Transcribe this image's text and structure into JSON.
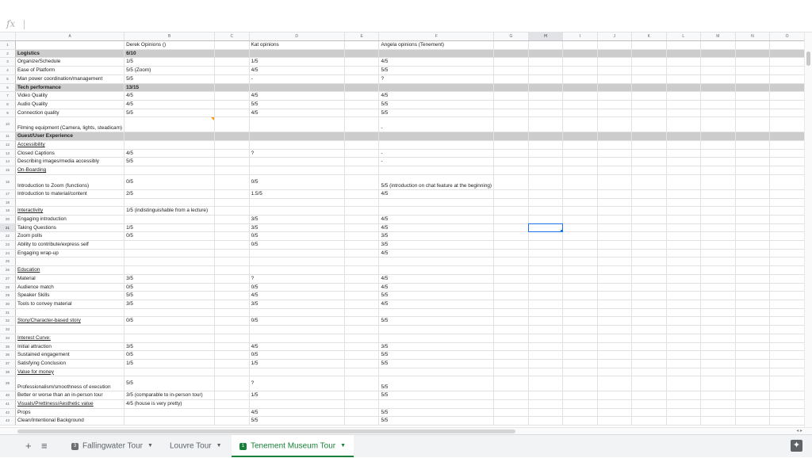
{
  "formula_bar": {
    "fx_label": "fx"
  },
  "columns": [
    "A",
    "B",
    "C",
    "D",
    "E",
    "F",
    "G",
    "H",
    "I",
    "J",
    "K",
    "L",
    "M",
    "N",
    "O"
  ],
  "selected_column": "H",
  "selected_row": "21",
  "rows": [
    {
      "n": "1",
      "a": "",
      "b": "Derek Opinions ()",
      "d": "Kat opinions",
      "f": "Angela opinions (Tenement)"
    },
    {
      "n": "2",
      "a": "Logistics",
      "b": "6/10",
      "d": "",
      "f": ""
    },
    {
      "n": "3",
      "a": "Organize/Schedule",
      "b": "1/5",
      "d": "1/5",
      "f": "4/5"
    },
    {
      "n": "4",
      "a": "Ease of Platform",
      "b": "5/5 (Zoom)",
      "d": "4/5",
      "f": "5/5"
    },
    {
      "n": "5",
      "a": "Man power coordination/management",
      "b": "5/5",
      "d": "-",
      "f": "?"
    },
    {
      "n": "6",
      "a": "Tech performance",
      "b": "13/15",
      "d": "",
      "f": ""
    },
    {
      "n": "7",
      "a": "Video Quality",
      "b": "4/5",
      "d": "4/5",
      "f": "4/5"
    },
    {
      "n": "8",
      "a": "Audio Quality",
      "b": "4/5",
      "d": "5/5",
      "f": "5/5"
    },
    {
      "n": "9",
      "a": "Connection quality",
      "b": "5/5",
      "d": "4/5",
      "f": "5/5"
    },
    {
      "n": "10",
      "a": "Filming equipment (Camera, lights, steadicam)",
      "b": "",
      "d": "",
      "f": "-"
    },
    {
      "n": "11",
      "a": "Guest/User Experience",
      "b": "",
      "d": "",
      "f": ""
    },
    {
      "n": "12",
      "a": "Accessibility",
      "b": "",
      "d": "",
      "f": ""
    },
    {
      "n": "13",
      "a": "Closed Captions",
      "b": "4/5",
      "d": "?",
      "f": "-"
    },
    {
      "n": "14",
      "a": "Describing images/media accessibly",
      "b": "5/5",
      "d": "",
      "f": "-"
    },
    {
      "n": "15",
      "a": "On-Boarding",
      "b": "",
      "d": "",
      "f": ""
    },
    {
      "n": "16",
      "a": "Introduction to Zoom (functions)",
      "b": "0/5",
      "d": "0/5",
      "f": "5/5 (introduction on chat feature at the beginning)"
    },
    {
      "n": "17",
      "a": "Introduction to material/content",
      "b": "2/5",
      "d": "1.5/5",
      "f": "4/5"
    },
    {
      "n": "18",
      "a": "",
      "b": "",
      "d": "",
      "f": ""
    },
    {
      "n": "19",
      "a": "Interactivity",
      "b": "1/5 (indistinguishable from a lecture)",
      "d": "",
      "f": ""
    },
    {
      "n": "20",
      "a": "Engaging introduction",
      "b": "",
      "d": "3/5",
      "f": "4/5"
    },
    {
      "n": "21",
      "a": "Taking Questions",
      "b": "1/5",
      "d": "3/5",
      "f": "4/5"
    },
    {
      "n": "22",
      "a": "Zoom polls",
      "b": "0/5",
      "d": "0/5",
      "f": "3/5"
    },
    {
      "n": "23",
      "a": "Ability to contribute/express self",
      "b": "",
      "d": "0/5",
      "f": "3/5"
    },
    {
      "n": "24",
      "a": "Engaging wrap-up",
      "b": "",
      "d": "",
      "f": "4/5"
    },
    {
      "n": "25",
      "a": "",
      "b": "",
      "d": "",
      "f": ""
    },
    {
      "n": "26",
      "a": "Education",
      "b": "",
      "d": "",
      "f": ""
    },
    {
      "n": "27",
      "a": "Material",
      "b": "3/5",
      "d": "?",
      "f": "4/5"
    },
    {
      "n": "28",
      "a": "Audience match",
      "b": "0/5",
      "d": "0/5",
      "f": "4/5"
    },
    {
      "n": "29",
      "a": "Speaker Skills",
      "b": "5/5",
      "d": "4/5",
      "f": "5/5"
    },
    {
      "n": "30",
      "a": "Tools to convey material",
      "b": "3/5",
      "d": "3/5",
      "f": "4/5"
    },
    {
      "n": "31",
      "a": "",
      "b": "",
      "d": "",
      "f": ""
    },
    {
      "n": "32",
      "a": "Story/Character-based story",
      "b": "0/5",
      "d": "0/5",
      "f": "5/5"
    },
    {
      "n": "33",
      "a": "",
      "b": "",
      "d": "",
      "f": ""
    },
    {
      "n": "34",
      "a": "Interest Curve:",
      "b": "",
      "d": "",
      "f": ""
    },
    {
      "n": "35",
      "a": "Initial attraction",
      "b": "3/5",
      "d": "4/5",
      "f": "3/5"
    },
    {
      "n": "36",
      "a": "Sustained engagement",
      "b": "0/5",
      "d": "0/5",
      "f": "5/5"
    },
    {
      "n": "37",
      "a": "Satisfying Conclusion",
      "b": "1/5",
      "d": "1/5",
      "f": "5/5"
    },
    {
      "n": "38",
      "a": "Value for money",
      "b": "",
      "d": "",
      "f": ""
    },
    {
      "n": "39",
      "a": "Professionalism/smoothness of execution",
      "b": "5/5",
      "d": "?",
      "f": "5/5"
    },
    {
      "n": "40",
      "a": "Better or worse than an in-person tour",
      "b": "3/5 (comparable to in-person tour)",
      "d": "1/5",
      "f": "5/5"
    },
    {
      "n": "41",
      "a": "Visuals/Prettiness/Aesthetic value",
      "b": "4/5 (house is very pretty)",
      "d": "",
      "f": ""
    },
    {
      "n": "42",
      "a": "Props",
      "b": "",
      "d": "4/5",
      "f": "5/5"
    },
    {
      "n": "43",
      "a": "Clean/Intentional Background",
      "b": "",
      "d": "5/5",
      "f": "5/5"
    }
  ],
  "sheet_bar": {
    "add_icon": "plus-icon",
    "list_icon": "hamburger-icon",
    "tabs": [
      {
        "label": "Fallingwater Tour",
        "badge": "3"
      },
      {
        "label": "Louvre Tour",
        "badge": ""
      },
      {
        "label": "Tenement Museum Tour",
        "badge": "1"
      }
    ],
    "explore_icon": "explore-icon"
  }
}
